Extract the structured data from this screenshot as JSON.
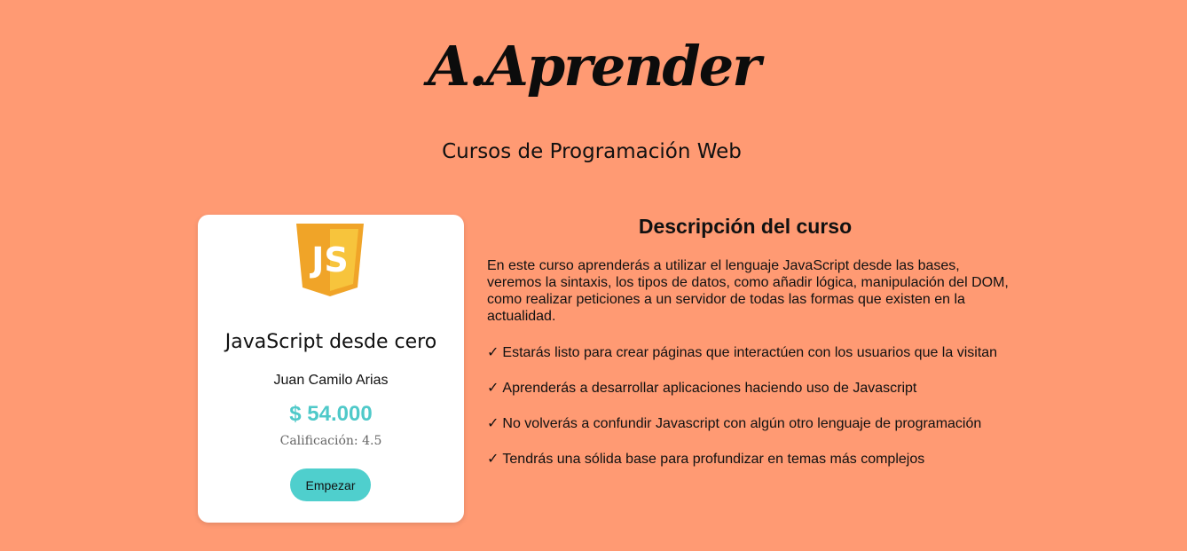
{
  "header": {
    "logo_text": "A.Aprender",
    "subtitle": "Cursos de Programación Web"
  },
  "course_card": {
    "logo_icon": "javascript-logo",
    "logo_text": "JS",
    "title": "JavaScript desde cero",
    "instructor": "Juan Camilo Arias",
    "price": "$ 54.000",
    "rating_label": "Calificación:",
    "rating_value": "4.5",
    "start_button": "Empezar"
  },
  "description": {
    "title": "Descripción del curso",
    "text": "En este curso aprenderás a utilizar el lenguaje JavaScript desde las bases, veremos la sintaxis, los tipos de datos, como añadir lógica, manipulación del DOM, como realizar peticiones a un servidor de todas las formas que existen en la actualidad.",
    "check_glyph": "✓",
    "bullets": [
      "Estarás listo para crear páginas que interactúen con los usuarios que la visitan",
      "Aprenderás a desarrollar aplicaciones haciendo uso de Javascript",
      "No volverás a confundir Javascript con algún otro lenguaje de programación",
      "Tendrás una sólida base para profundizar en temas más complejos"
    ]
  },
  "colors": {
    "background": "#ff9a73",
    "card": "#ffffff",
    "accent": "#4fc9c9",
    "js_orange": "#f0a428",
    "js_yellow": "#f7d03c"
  }
}
